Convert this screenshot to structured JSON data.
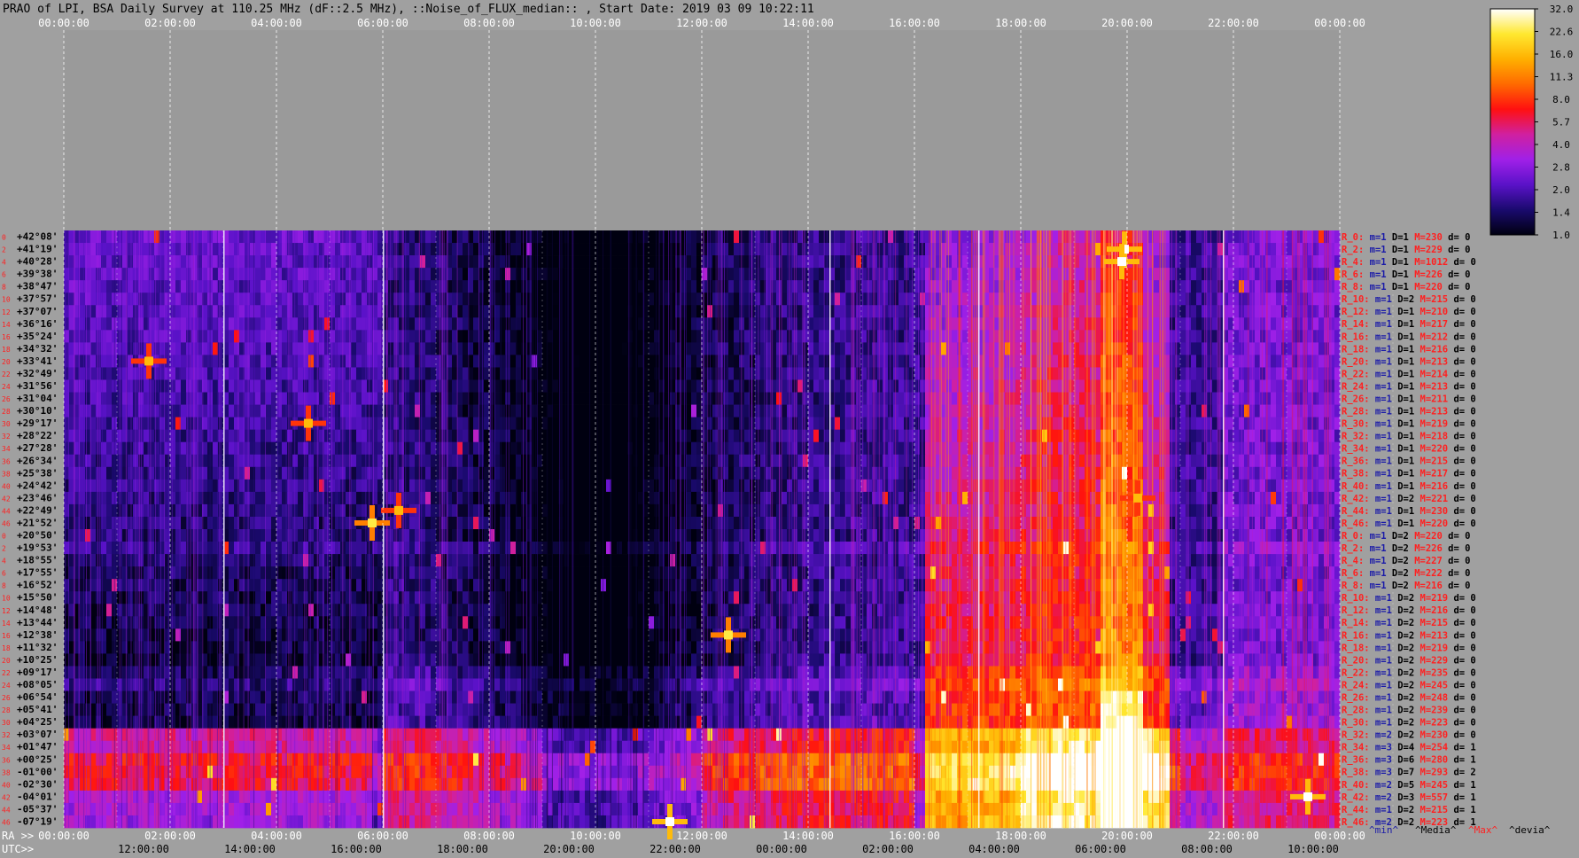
{
  "chart_data": {
    "type": "heatmap",
    "title": "PRAO of LPI, BSA Daily Survey at 110.25 MHz (dF::2.5 MHz), ::Noise_of_FLUX_median:: , Start Date: 2019 03 09 10:22:11",
    "x_top_ticks": [
      "00:00:00",
      "02:00:00",
      "04:00:00",
      "06:00:00",
      "08:00:00",
      "10:00:00",
      "12:00:00",
      "14:00:00",
      "16:00:00",
      "18:00:00",
      "20:00:00",
      "22:00:00",
      "00:00:00"
    ],
    "ra_label": "RA >>",
    "ra_ticks": [
      "00:00:00",
      "02:00:00",
      "04:00:00",
      "06:00:00",
      "08:00:00",
      "10:00:00",
      "12:00:00",
      "14:00:00",
      "16:00:00",
      "18:00:00",
      "20:00:00",
      "22:00:00",
      "00:00:00"
    ],
    "utc_label": "UTC>>",
    "utc_ticks": [
      "12:00:00",
      "14:00:00",
      "16:00:00",
      "18:00:00",
      "20:00:00",
      "22:00:00",
      "00:00:00",
      "02:00:00",
      "04:00:00",
      "06:00:00",
      "08:00:00",
      "10:00:00"
    ],
    "colorbar": {
      "ticks": [
        "32.0",
        "22.6",
        "16.0",
        "11.3",
        "8.0",
        "5.7",
        "4.0",
        "2.8",
        "2.0",
        "1.4",
        "1.0"
      ],
      "range": [
        1.0,
        32.0
      ],
      "scale": "log",
      "colors": [
        "#000010",
        "#1a0a6e",
        "#5a12c8",
        "#a020e8",
        "#d020a0",
        "#ff1010",
        "#ff6a00",
        "#ffb000",
        "#ffe830",
        "#ffffff"
      ]
    },
    "declinations": [
      "+42°08'",
      "+41°19'",
      "+40°28'",
      "+39°38'",
      "+38°47'",
      "+37°57'",
      "+37°07'",
      "+36°16'",
      "+35°24'",
      "+34°32'",
      "+33°41'",
      "+32°49'",
      "+31°56'",
      "+31°04'",
      "+30°10'",
      "+29°17'",
      "+28°22'",
      "+27°28'",
      "+26°34'",
      "+25°38'",
      "+24°42'",
      "+23°46'",
      "+22°49'",
      "+21°52'",
      "+20°50'",
      "+19°53'",
      "+18°55'",
      "+17°55'",
      "+16°52'",
      "+15°50'",
      "+14°48'",
      "+13°44'",
      "+12°38'",
      "+11°32'",
      "+10°25'",
      "+09°17'",
      "+08°05'",
      "+06°54'",
      "+05°41'",
      "+04°25'",
      "+03°07'",
      "+01°47'",
      "+00°25'",
      "-01°00'",
      "-02°30'",
      "-04°01'",
      "-05°37'",
      "-07°19'"
    ],
    "row_indices": [
      "0",
      "2",
      "4",
      "6",
      "8",
      "10",
      "12",
      "14",
      "16",
      "18",
      "20",
      "22",
      "24",
      "26",
      "28",
      "30",
      "32",
      "34",
      "36",
      "38",
      "40",
      "42",
      "44",
      "46",
      "0",
      "2",
      "4",
      "6",
      "8",
      "10",
      "12",
      "14",
      "16",
      "18",
      "20",
      "22",
      "24",
      "26",
      "28",
      "30",
      "32",
      "34",
      "36",
      "38",
      "40",
      "42",
      "44",
      "46"
    ],
    "row_stats": [
      {
        "r": "R_0:",
        "m": "m=1",
        "d": "D=1",
        "M": "M=230",
        "dv": "d= 0"
      },
      {
        "r": "R_2:",
        "m": "m=1",
        "d": "D=1",
        "M": "M=229",
        "dv": "d= 0"
      },
      {
        "r": "R_4:",
        "m": "m=1",
        "d": "D=1",
        "M": "M=1012",
        "dv": "d= 0"
      },
      {
        "r": "R_6:",
        "m": "m=1",
        "d": "D=1",
        "M": "M=226",
        "dv": "d= 0"
      },
      {
        "r": "R_8:",
        "m": "m=1",
        "d": "D=1",
        "M": "M=220",
        "dv": "d= 0"
      },
      {
        "r": "R_10:",
        "m": "m=1",
        "d": "D=2",
        "M": "M=215",
        "dv": "d= 0"
      },
      {
        "r": "R_12:",
        "m": "m=1",
        "d": "D=1",
        "M": "M=210",
        "dv": "d= 0"
      },
      {
        "r": "R_14:",
        "m": "m=1",
        "d": "D=1",
        "M": "M=217",
        "dv": "d= 0"
      },
      {
        "r": "R_16:",
        "m": "m=1",
        "d": "D=1",
        "M": "M=212",
        "dv": "d= 0"
      },
      {
        "r": "R_18:",
        "m": "m=1",
        "d": "D=1",
        "M": "M=216",
        "dv": "d= 0"
      },
      {
        "r": "R_20:",
        "m": "m=1",
        "d": "D=1",
        "M": "M=213",
        "dv": "d= 0"
      },
      {
        "r": "R_22:",
        "m": "m=1",
        "d": "D=1",
        "M": "M=214",
        "dv": "d= 0"
      },
      {
        "r": "R_24:",
        "m": "m=1",
        "d": "D=1",
        "M": "M=213",
        "dv": "d= 0"
      },
      {
        "r": "R_26:",
        "m": "m=1",
        "d": "D=1",
        "M": "M=211",
        "dv": "d= 0"
      },
      {
        "r": "R_28:",
        "m": "m=1",
        "d": "D=1",
        "M": "M=213",
        "dv": "d= 0"
      },
      {
        "r": "R_30:",
        "m": "m=1",
        "d": "D=1",
        "M": "M=219",
        "dv": "d= 0"
      },
      {
        "r": "R_32:",
        "m": "m=1",
        "d": "D=1",
        "M": "M=218",
        "dv": "d= 0"
      },
      {
        "r": "R_34:",
        "m": "m=1",
        "d": "D=1",
        "M": "M=220",
        "dv": "d= 0"
      },
      {
        "r": "R_36:",
        "m": "m=1",
        "d": "D=1",
        "M": "M=215",
        "dv": "d= 0"
      },
      {
        "r": "R_38:",
        "m": "m=1",
        "d": "D=1",
        "M": "M=217",
        "dv": "d= 0"
      },
      {
        "r": "R_40:",
        "m": "m=1",
        "d": "D=1",
        "M": "M=216",
        "dv": "d= 0"
      },
      {
        "r": "R_42:",
        "m": "m=1",
        "d": "D=2",
        "M": "M=221",
        "dv": "d= 0"
      },
      {
        "r": "R_44:",
        "m": "m=1",
        "d": "D=1",
        "M": "M=230",
        "dv": "d= 0"
      },
      {
        "r": "R_46:",
        "m": "m=1",
        "d": "D=1",
        "M": "M=220",
        "dv": "d= 0"
      },
      {
        "r": "R_0:",
        "m": "m=1",
        "d": "D=2",
        "M": "M=220",
        "dv": "d= 0"
      },
      {
        "r": "R_2:",
        "m": "m=1",
        "d": "D=2",
        "M": "M=226",
        "dv": "d= 0"
      },
      {
        "r": "R_4:",
        "m": "m=1",
        "d": "D=2",
        "M": "M=227",
        "dv": "d= 0"
      },
      {
        "r": "R_6:",
        "m": "m=1",
        "d": "D=2",
        "M": "M=222",
        "dv": "d= 0"
      },
      {
        "r": "R_8:",
        "m": "m=1",
        "d": "D=2",
        "M": "M=216",
        "dv": "d= 0"
      },
      {
        "r": "R_10:",
        "m": "m=1",
        "d": "D=2",
        "M": "M=219",
        "dv": "d= 0"
      },
      {
        "r": "R_12:",
        "m": "m=1",
        "d": "D=2",
        "M": "M=216",
        "dv": "d= 0"
      },
      {
        "r": "R_14:",
        "m": "m=1",
        "d": "D=2",
        "M": "M=215",
        "dv": "d= 0"
      },
      {
        "r": "R_16:",
        "m": "m=1",
        "d": "D=2",
        "M": "M=213",
        "dv": "d= 0"
      },
      {
        "r": "R_18:",
        "m": "m=1",
        "d": "D=2",
        "M": "M=219",
        "dv": "d= 0"
      },
      {
        "r": "R_20:",
        "m": "m=1",
        "d": "D=2",
        "M": "M=229",
        "dv": "d= 0"
      },
      {
        "r": "R_22:",
        "m": "m=1",
        "d": "D=2",
        "M": "M=235",
        "dv": "d= 0"
      },
      {
        "r": "R_24:",
        "m": "m=1",
        "d": "D=2",
        "M": "M=245",
        "dv": "d= 0"
      },
      {
        "r": "R_26:",
        "m": "m=1",
        "d": "D=2",
        "M": "M=248",
        "dv": "d= 0"
      },
      {
        "r": "R_28:",
        "m": "m=1",
        "d": "D=2",
        "M": "M=239",
        "dv": "d= 0"
      },
      {
        "r": "R_30:",
        "m": "m=1",
        "d": "D=2",
        "M": "M=223",
        "dv": "d= 0"
      },
      {
        "r": "R_32:",
        "m": "m=2",
        "d": "D=2",
        "M": "M=230",
        "dv": "d= 0"
      },
      {
        "r": "R_34:",
        "m": "m=3",
        "d": "D=4",
        "M": "M=254",
        "dv": "d= 1"
      },
      {
        "r": "R_36:",
        "m": "m=3",
        "d": "D=6",
        "M": "M=280",
        "dv": "d= 1"
      },
      {
        "r": "R_38:",
        "m": "m=3",
        "d": "D=7",
        "M": "M=293",
        "dv": "d= 2"
      },
      {
        "r": "R_40:",
        "m": "m=2",
        "d": "D=5",
        "M": "M=245",
        "dv": "d= 1"
      },
      {
        "r": "R_42:",
        "m": "m=2",
        "d": "D=3",
        "M": "M=557",
        "dv": "d= 1"
      },
      {
        "r": "R_44:",
        "m": "m=1",
        "d": "D=2",
        "M": "M=215",
        "dv": "d= 1"
      },
      {
        "r": "R_46:",
        "m": "m=2",
        "d": "D=2",
        "M": "M=223",
        "dv": "d= 1"
      }
    ],
    "stats_legend": [
      "^min^",
      "^Media^",
      "^Max^",
      "^devia^"
    ],
    "hotspots": [
      {
        "ra_h": 19.95,
        "row": 1,
        "v": 32
      },
      {
        "ra_h": 19.9,
        "row": 2,
        "v": 32
      },
      {
        "ra_h": 5.8,
        "row": 23,
        "v": 22.6
      },
      {
        "ra_h": 12.5,
        "row": 32,
        "v": 22.6
      },
      {
        "ra_h": 11.4,
        "row": 47,
        "v": 32
      },
      {
        "ra_h": 23.4,
        "row": 45,
        "v": 32
      },
      {
        "ra_h": 20.2,
        "row": 21,
        "v": 16
      },
      {
        "ra_h": 6.3,
        "row": 22,
        "v": 16
      },
      {
        "ra_h": 1.6,
        "row": 10,
        "v": 16
      },
      {
        "ra_h": 4.6,
        "row": 15,
        "v": 16
      }
    ]
  }
}
